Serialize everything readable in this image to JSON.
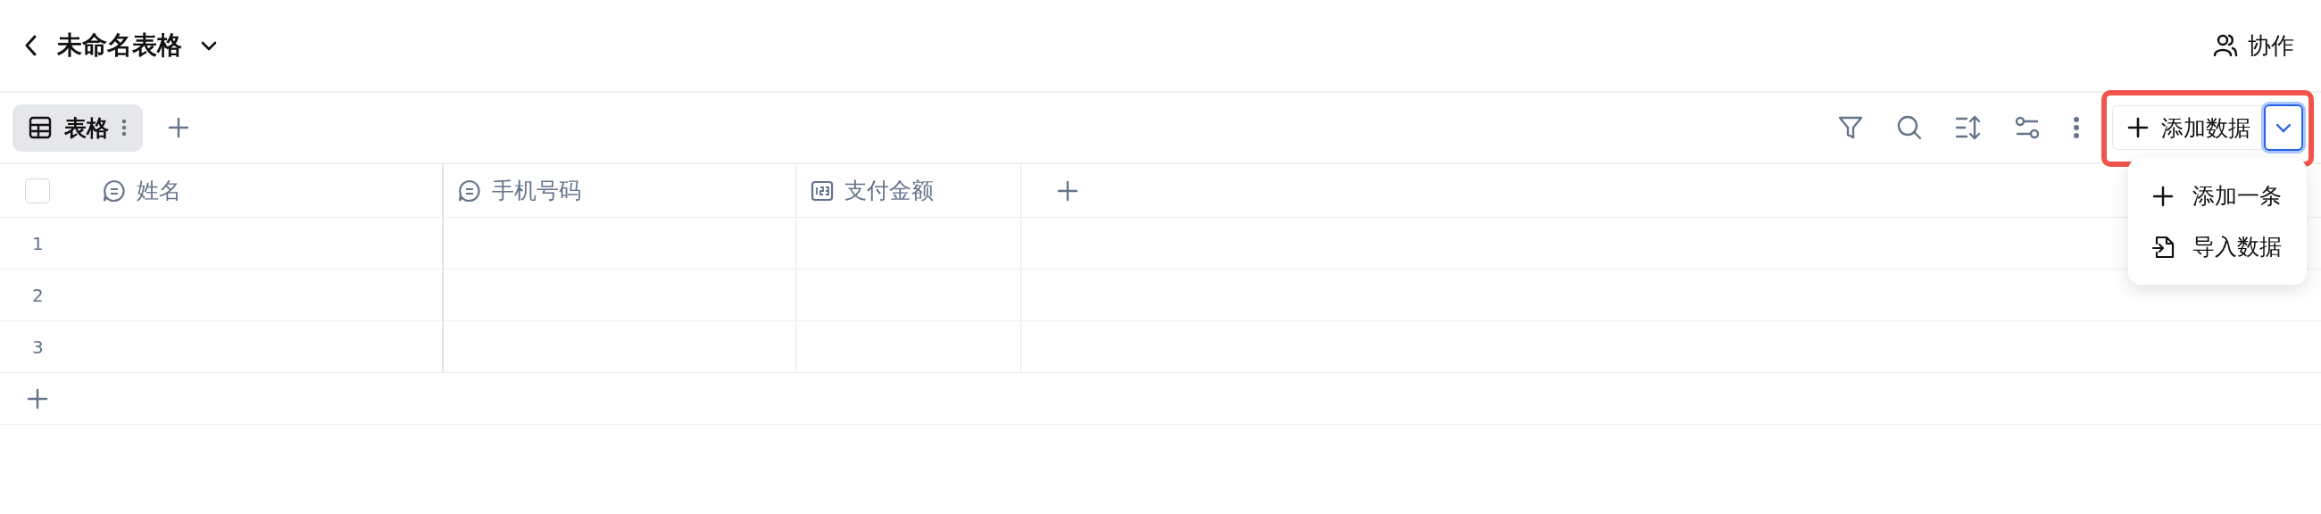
{
  "header": {
    "title": "未命名表格",
    "collab": "协作"
  },
  "views": [
    {
      "label": "表格",
      "selected": true
    }
  ],
  "toolbar": {
    "add_button": "添加数据",
    "highlighted": true,
    "menu": [
      {
        "label": "添加一条",
        "kind": "add"
      },
      {
        "label": "导入数据",
        "kind": "import"
      }
    ]
  },
  "table": {
    "select_all": {
      "checked": false
    },
    "columns": [
      {
        "label": "姓名",
        "kind": "text"
      },
      {
        "label": "手机号码",
        "kind": "text"
      },
      {
        "label": "支付金额",
        "kind": "number"
      }
    ],
    "rows": [
      "1",
      "2",
      "3"
    ]
  }
}
